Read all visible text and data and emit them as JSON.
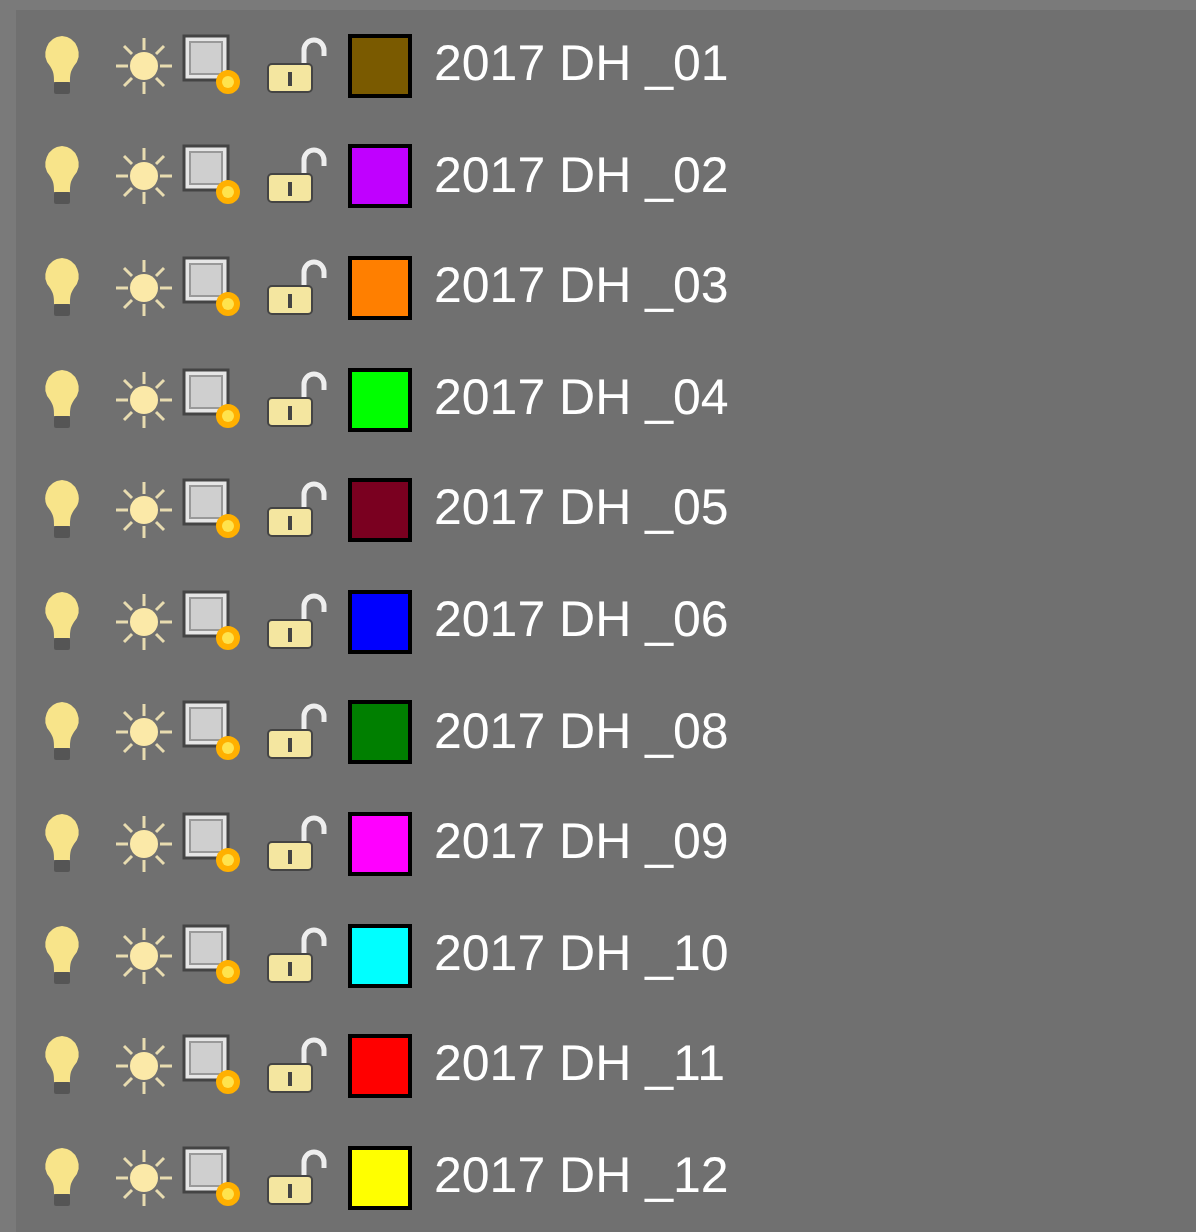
{
  "layers": [
    {
      "name": "2017 DH _01",
      "color": "#7a5a00",
      "on": true,
      "frozen": false,
      "locked": false
    },
    {
      "name": "2017 DH _02",
      "color": "#c000ff",
      "on": true,
      "frozen": false,
      "locked": false
    },
    {
      "name": "2017 DH _03",
      "color": "#ff7f00",
      "on": true,
      "frozen": false,
      "locked": false
    },
    {
      "name": "2017 DH _04",
      "color": "#00ff00",
      "on": true,
      "frozen": false,
      "locked": false
    },
    {
      "name": "2017 DH _05",
      "color": "#7a0020",
      "on": true,
      "frozen": false,
      "locked": false
    },
    {
      "name": "2017 DH _06",
      "color": "#0000ff",
      "on": true,
      "frozen": false,
      "locked": false
    },
    {
      "name": "2017 DH _08",
      "color": "#007f00",
      "on": true,
      "frozen": false,
      "locked": false
    },
    {
      "name": "2017 DH _09",
      "color": "#ff00ff",
      "on": true,
      "frozen": false,
      "locked": false
    },
    {
      "name": "2017 DH _10",
      "color": "#00ffff",
      "on": true,
      "frozen": false,
      "locked": false
    },
    {
      "name": "2017 DH _11",
      "color": "#ff0000",
      "on": true,
      "frozen": false,
      "locked": false
    },
    {
      "name": "2017 DH _12",
      "color": "#ffff00",
      "on": true,
      "frozen": false,
      "locked": false
    }
  ]
}
